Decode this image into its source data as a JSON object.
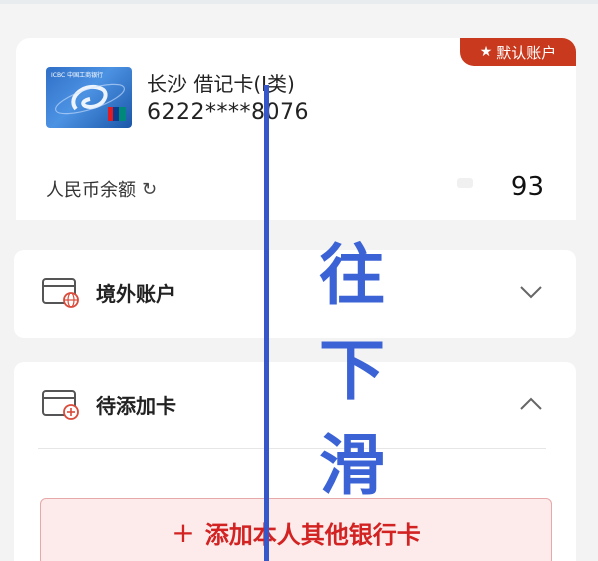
{
  "account_card": {
    "default_badge": "默认账户",
    "bank_line": "长沙 借记卡(I类)",
    "card_number": "6222****8076",
    "balance_label": "人民币余额",
    "balance_value": "93",
    "card_image_text": "ICBC 中国工商银行"
  },
  "sections": {
    "overseas": {
      "title": "境外账户",
      "state": "collapsed"
    },
    "pending": {
      "title": "待添加卡",
      "state": "expanded"
    }
  },
  "add_card_button": {
    "label": "添加本人其他银行卡"
  },
  "overlay": {
    "swipe_hint": [
      "往",
      "下",
      "滑"
    ]
  },
  "colors": {
    "badge": "#c8391d",
    "add_button_text": "#d22222",
    "add_button_bg": "#fdeaea",
    "annotation": "#3b63d6"
  },
  "icons": [
    "star-icon",
    "refresh-icon",
    "overseas-card-icon",
    "pending-card-icon",
    "chevron-down-icon",
    "chevron-up-icon",
    "plus-icon"
  ]
}
